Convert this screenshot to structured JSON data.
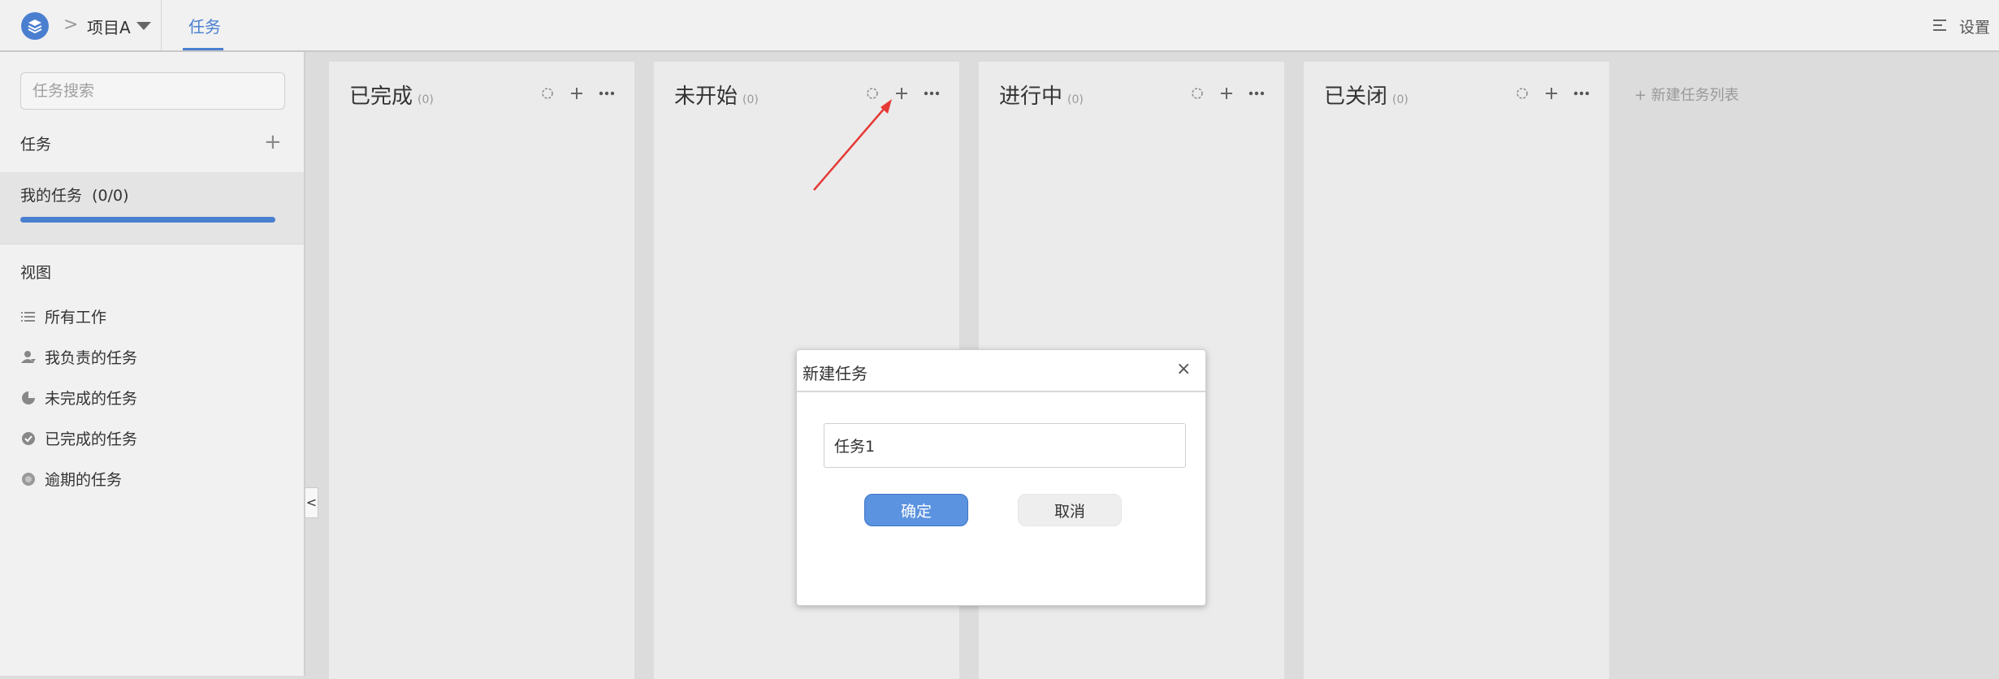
{
  "header": {
    "crumb_separator": ">",
    "project_name": "项目A",
    "tab_label": "任务",
    "settings_label": "设置"
  },
  "sidebar": {
    "search_placeholder": "任务搜索",
    "tasks_heading": "任务",
    "add_symbol": "+",
    "my_tasks_label": "我的任务  (0/0)",
    "my_tasks_progress": 1.0,
    "views_heading": "视图",
    "views": [
      {
        "label": "所有工作",
        "icon": "list-icon"
      },
      {
        "label": "我负责的任务",
        "icon": "person-icon"
      },
      {
        "label": "未完成的任务",
        "icon": "pie-icon"
      },
      {
        "label": "已完成的任务",
        "icon": "check-circle-icon"
      },
      {
        "label": "逾期的任务",
        "icon": "overdue-icon"
      }
    ],
    "collapse_label": "<"
  },
  "board": {
    "columns": [
      {
        "title": "已完成",
        "count": "(0)"
      },
      {
        "title": "未开始",
        "count": "(0)"
      },
      {
        "title": "进行中",
        "count": "(0)"
      },
      {
        "title": "已关闭",
        "count": "(0)"
      }
    ],
    "new_list_label": "+ 新建任务列表"
  },
  "modal": {
    "title": "新建任务",
    "close_symbol": "×",
    "input_value": "任务1",
    "ok_label": "确定",
    "cancel_label": "取消"
  },
  "colors": {
    "accent": "#4a7fd0",
    "annotation_arrow": "#e53935"
  }
}
